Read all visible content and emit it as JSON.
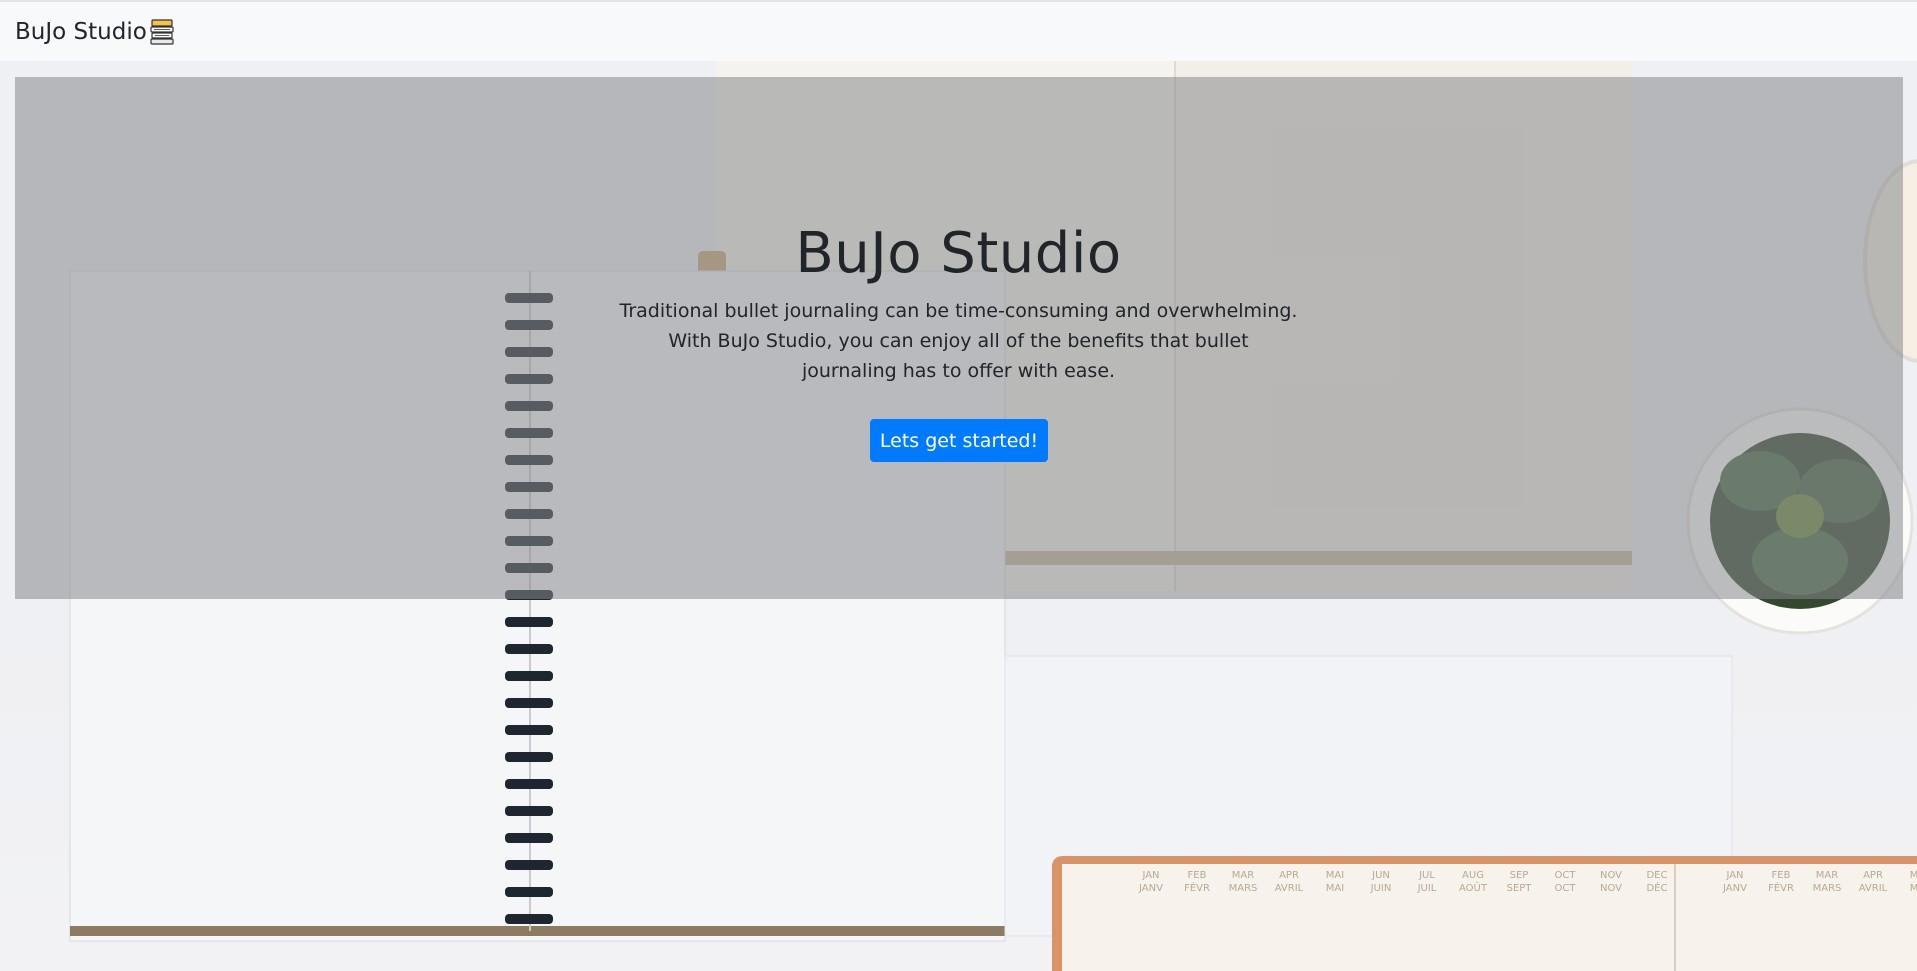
{
  "navbar": {
    "brand_label": "BuJo Studio",
    "brand_icon": "stacked-books-icon"
  },
  "hero": {
    "title": "BuJo Studio",
    "lead": "Traditional bullet journaling can be time-consuming and overwhelming. With BuJo Studio, you can enjoy all of the benefits that bullet journaling has to offer with ease.",
    "cta_label": "Lets get started!"
  },
  "planner": {
    "months_row1": [
      "JAN",
      "FEB",
      "MAR",
      "APR",
      "MAI",
      "JUN",
      "JUL",
      "AUG",
      "SEP",
      "OCT",
      "NOV",
      "DEC"
    ],
    "months_row2": [
      "JANV",
      "FÉVR",
      "MARS",
      "AVRIL",
      "MAI",
      "JUIN",
      "JUIL",
      "AOÛT",
      "SEPT",
      "OCT",
      "NOV",
      "DÉC"
    ],
    "months_right_row1": [
      "JAN",
      "FEB",
      "MAR",
      "APR",
      "MAI"
    ],
    "months_right_row2": [
      "JANV",
      "FÉVR",
      "MARS",
      "AVRIL",
      "MAI"
    ]
  },
  "colors": {
    "navbar_bg": "#f8f9fa",
    "overlay": "rgba(134,136,140,0.55)",
    "primary": "#007bff",
    "text": "#212529"
  }
}
